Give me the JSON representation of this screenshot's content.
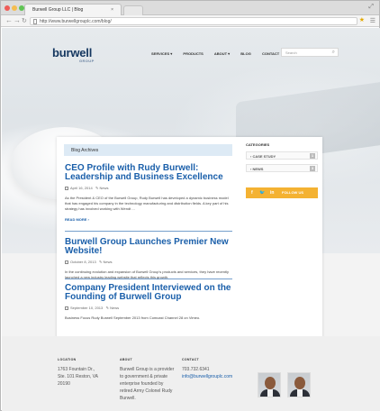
{
  "browser": {
    "tab_title": "Burwell Group LLC | Blog",
    "tab_close": "×",
    "url": "http://www.burwellgrouplc.com/blog/"
  },
  "site": {
    "logo": "burwell",
    "logo_sub": "GROUP",
    "nav": [
      "SERVICES ▾",
      "PRODUCTS",
      "ABOUT ▾",
      "BLOG",
      "CONTACT"
    ],
    "search_placeholder": "Search"
  },
  "blog": {
    "heading": "Blog Archives",
    "posts": [
      {
        "title": "CEO Profile with Rudy Burwell: Leadership and Business Excellence",
        "date": "April 16, 2014",
        "category": "News",
        "excerpt": "As the President & CEO of the Burwell Group, Rudy Burwell has developed a dynamic business model that has engaged his company in the technology manufacturing and distribution fields. A key part of his strategy has involved working with Wendt ...",
        "read_more": "READ MORE ›"
      },
      {
        "title": "Burwell Group Launches Premier New Website!",
        "date": "October 8, 2013",
        "category": "News",
        "excerpt": "In the continuing evolution and expansion of Burwell Group's products and services, they have recently launched a new industry leading website that reflects this growth."
      },
      {
        "title": "Company President Interviewed on the Founding of Burwell Group",
        "date": "September 10, 2013",
        "category": "News",
        "excerpt": "Business Focus Rudy Burwell September 2013 from Comcast Channel 28 on Vimeo."
      }
    ]
  },
  "sidebar": {
    "categories_title": "CATEGORIES",
    "categories": [
      {
        "label": "› CASE STUDY",
        "count": "1"
      },
      {
        "label": "› NEWS",
        "count": "3"
      }
    ],
    "social": {
      "f": "f",
      "t": "🐦",
      "in": "in",
      "label": "FOLLOW US"
    }
  },
  "footer": {
    "location_title": "LOCATION",
    "location_lines": [
      "1763 Fountain Dr.,",
      "Ste. 101 Reston, VA",
      "20190"
    ],
    "about_title": "ABOUT",
    "about_lines": [
      "Burwell Group is a provider",
      "to government & private",
      "enterprise founded by",
      "retired Army Colonel Rudy",
      "Burwell."
    ],
    "contact_title": "CONTACT",
    "phone": "703.732.6341",
    "email": "info@burwellgrouplc.com"
  },
  "colors": {
    "brand_blue": "#1a5faa",
    "accent_orange": "#f4b232",
    "logo_navy": "#14365f"
  }
}
